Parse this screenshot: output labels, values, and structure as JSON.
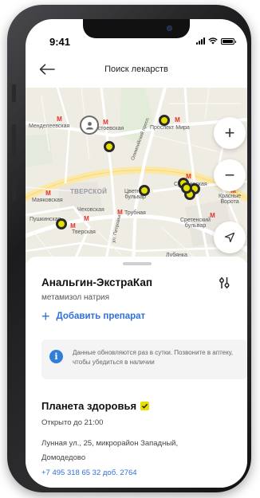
{
  "status_bar": {
    "time": "9:41"
  },
  "header": {
    "title": "Поиск лекарств",
    "back_icon": "arrow-left-icon"
  },
  "map": {
    "labels": {
      "mendeleevskaya": "Менделеевская",
      "dostoevskaya": "Достоевская",
      "prospekt_mira": "Проспект Мира",
      "olimpiyskiy": "Олимпийский просп.",
      "tverskoy": "ТВЕРСКОЙ",
      "tsvetnoy": "Цветной\nбульвар",
      "sukharevskaya": "Сухаревская",
      "mayakovskaya": "Маяковская",
      "chekhovskaya": "Чеховская",
      "trubnaya": "Трубная",
      "pushkinskaya": "Пушкинская",
      "tverskaya": "Тверская",
      "petrovka": "ул. Петровка",
      "sretensky": "Сретенский\nбульвар",
      "krasnye_vorota": "Красные\nВорота",
      "lubyanka": "Лубянка"
    },
    "buttons": {
      "zoom_in": "+",
      "zoom_out": "−",
      "locate_icon": "navigation-arrow-icon"
    },
    "metro_color": "#e3322b",
    "pin_color": "#e4e000"
  },
  "sheet": {
    "drug_name": "Анальгин-ЭкстраКап",
    "drug_substance": "метамизол натрия",
    "add_drug_label": "Добавить препарат",
    "info_text": "Данные обновляются раз в сутки. Позвоните в аптеку, чтобы убедиться в наличии",
    "pharmacy": {
      "name": "Планета здоровья",
      "hours": "Открыто до 21:00",
      "address": "Лунная ул., 25, микрорайон Западный, Домодедово",
      "phone": "+7 495 318 65 32 доб. 2764"
    },
    "accent_color": "#2f6fd8"
  }
}
